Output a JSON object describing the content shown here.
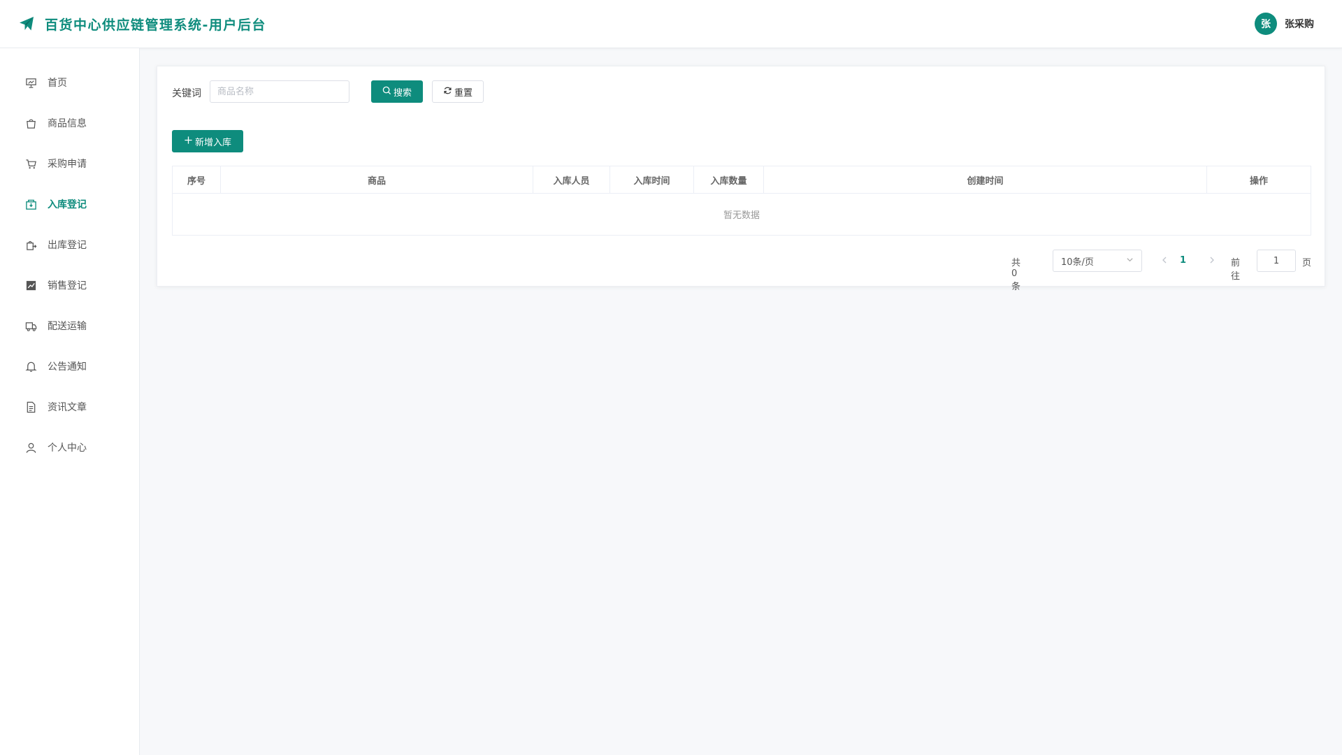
{
  "app": {
    "title": "百货中心供应链管理系统-用户后台",
    "logo_icon": "paper-plane-icon",
    "accent": "#0e8c7d"
  },
  "user": {
    "avatar_text": "张",
    "name": "张采购"
  },
  "sidebar": {
    "items": [
      {
        "label": "首页",
        "icon": "presentation-icon",
        "active": false
      },
      {
        "label": "商品信息",
        "icon": "shopping-bag-icon",
        "active": false
      },
      {
        "label": "采购申请",
        "icon": "shopping-cart-icon",
        "active": false
      },
      {
        "label": "入库登记",
        "icon": "box-in-icon",
        "active": true
      },
      {
        "label": "出库登记",
        "icon": "box-out-icon",
        "active": false
      },
      {
        "label": "销售登记",
        "icon": "chart-icon",
        "active": false
      },
      {
        "label": "配送运输",
        "icon": "truck-icon",
        "active": false
      },
      {
        "label": "公告通知",
        "icon": "bell-icon",
        "active": false
      },
      {
        "label": "资讯文章",
        "icon": "document-icon",
        "active": false
      },
      {
        "label": "个人中心",
        "icon": "user-icon",
        "active": false
      }
    ]
  },
  "search": {
    "keyword_label": "关键词",
    "placeholder": "商品名称",
    "value": "",
    "search_label": "搜索",
    "reset_label": "重置"
  },
  "actions": {
    "add_label": "新增入库"
  },
  "table": {
    "columns": [
      "序号",
      "商品",
      "入库人员",
      "入库时间",
      "入库数量",
      "创建时间",
      "操作"
    ],
    "rows": [],
    "empty_text": "暂无数据"
  },
  "pagination": {
    "total_text": "共 0 条",
    "page_size": "10条/页",
    "current_page": "1",
    "goto_label": "前往",
    "goto_value": "1",
    "page_unit": "页"
  }
}
